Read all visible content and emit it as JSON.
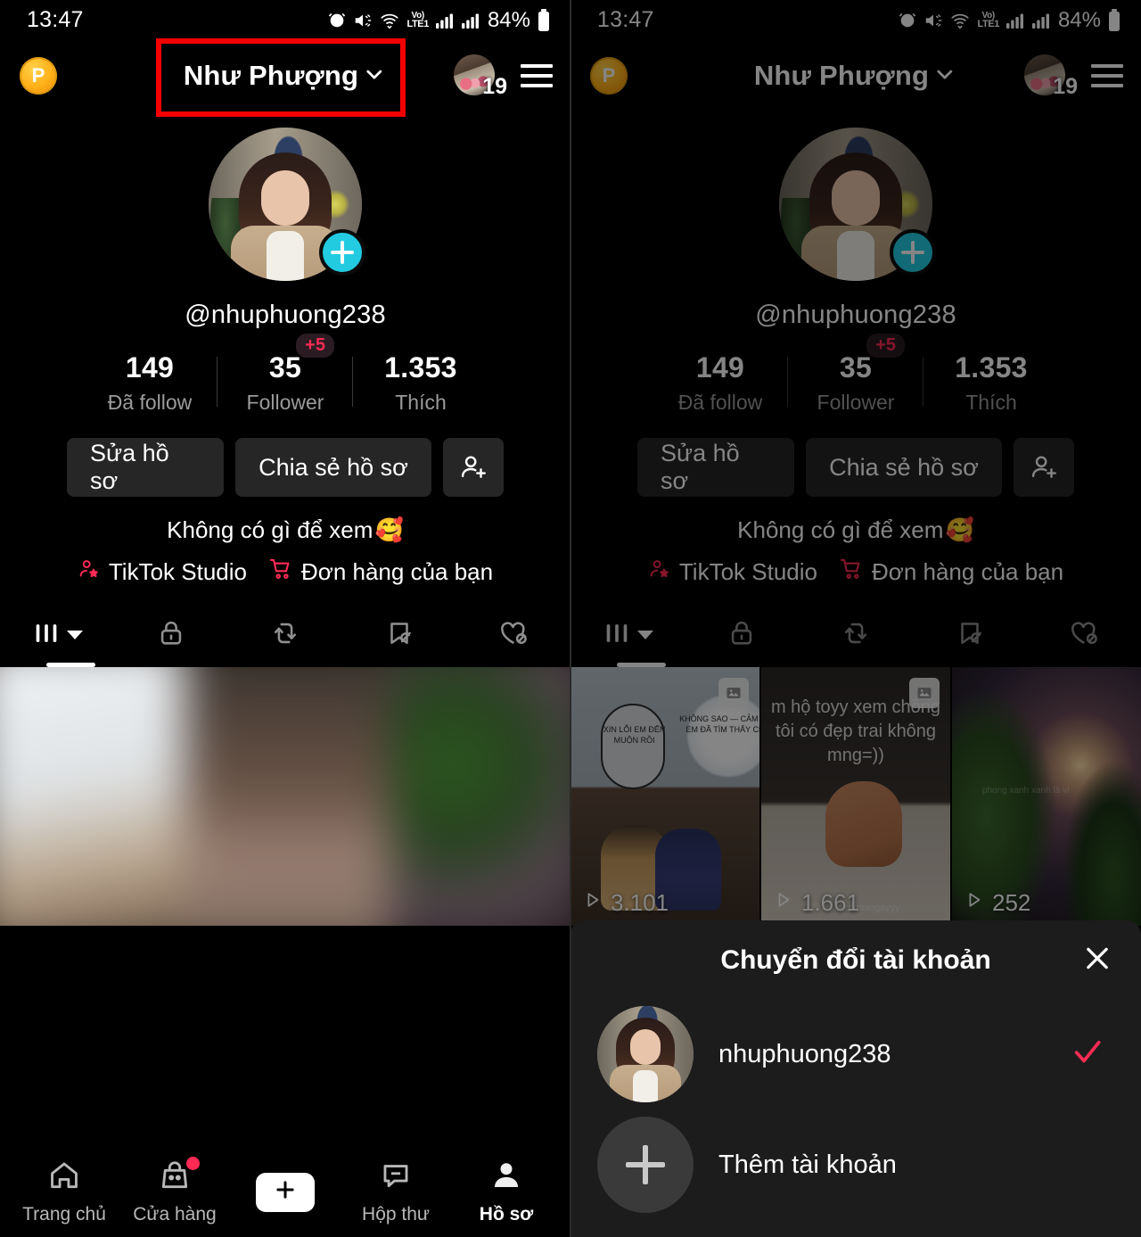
{
  "status_bar": {
    "time": "13:47",
    "battery_percent": "84%",
    "network_label_top": "Vo)",
    "network_label_bottom": "LTE1",
    "icons": [
      "alarm-icon",
      "mute-icon",
      "wifi-icon",
      "volte-icon",
      "signal-icon",
      "signal-icon",
      "battery-icon"
    ]
  },
  "app_bar": {
    "coin_label": "P",
    "title": "Như Phượng",
    "chevron_icon": "chevron-down-icon",
    "avatar_badge": "19",
    "menu_icon": "hamburger-menu-icon"
  },
  "profile": {
    "handle": "@nhuphuong238",
    "add_friend_icon": "plus-icon",
    "stats": [
      {
        "value": "149",
        "label": "Đã follow",
        "badge": ""
      },
      {
        "value": "35",
        "label": "Follower",
        "badge": "+5"
      },
      {
        "value": "1.353",
        "label": "Thích",
        "badge": ""
      }
    ],
    "buttons": {
      "edit": "Sửa hồ sơ",
      "share": "Chia sẻ hồ sơ",
      "add_user_icon": "add-person-icon"
    },
    "bio": "Không có gì để xem",
    "bio_emoji": "🥰",
    "links": [
      {
        "label": "TikTok Studio",
        "icon": "studio-person-star-icon"
      },
      {
        "label": "Đơn hàng của bạn",
        "icon": "shopping-cart-icon"
      }
    ],
    "tabs": [
      {
        "name": "posts",
        "icon": "grid-posts-icon",
        "active": true
      },
      {
        "name": "private",
        "icon": "lock-icon",
        "active": false
      },
      {
        "name": "reposts",
        "icon": "repost-icon",
        "active": false
      },
      {
        "name": "saved",
        "icon": "bookmark-hidden-icon",
        "active": false
      },
      {
        "name": "liked",
        "icon": "heart-hidden-icon",
        "active": false
      }
    ]
  },
  "videos": [
    {
      "plays": "3.101",
      "has_photo_stack": true,
      "caption": "XIN LỖI EM ĐẾN MUỘN RỒI",
      "caption2": "KHÔNG SAO — CẢM ƠN EM ĐÃ TÌM THẤY CHỊ"
    },
    {
      "plays": "1.661",
      "has_photo_stack": true,
      "caption": "m hộ toyy xem chồng tôi có đẹp trai không mng=))",
      "watermark": "@nacdepmoingayyy"
    },
    {
      "plays": "252",
      "has_photo_stack": false,
      "caption": "",
      "watermark": "phong xanh xanh là vì"
    }
  ],
  "bottom_nav": [
    {
      "label": "Trang chủ",
      "icon": "home-icon",
      "active": false,
      "dot": false
    },
    {
      "label": "Cửa hàng",
      "icon": "shop-bag-icon",
      "active": false,
      "dot": true
    },
    {
      "label": "",
      "icon": "create-plus-icon",
      "active": false,
      "dot": false
    },
    {
      "label": "Hộp thư",
      "icon": "inbox-icon",
      "active": false,
      "dot": false
    },
    {
      "label": "Hồ sơ",
      "icon": "profile-person-icon",
      "active": true,
      "dot": false
    }
  ],
  "switch_sheet": {
    "title": "Chuyển đổi tài khoản",
    "close_icon": "close-icon",
    "account": {
      "name": "nhuphuong238",
      "selected_icon": "check-icon"
    },
    "add_account": {
      "label": "Thêm tài khoản",
      "icon": "plus-icon"
    }
  },
  "colors": {
    "accent_red": "#ff2b55",
    "highlight_box": "#f40000",
    "cyan": "#22cbe0",
    "coin_gold": "#ffb018",
    "sheet_bg": "#1c1c1c",
    "button_bg": "#262626"
  }
}
